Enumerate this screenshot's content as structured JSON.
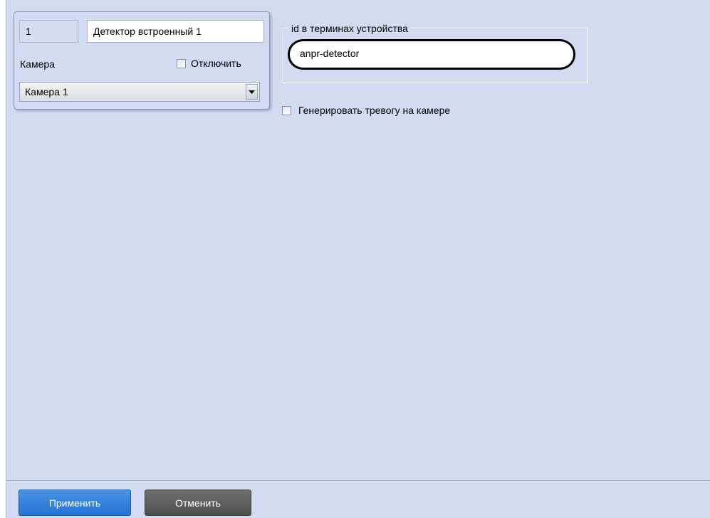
{
  "object_panel": {
    "id_value": "1",
    "name_value": "Детектор встроенный 1",
    "camera_label": "Камера",
    "disable_label": "Отключить",
    "disable_checked": false,
    "camera_selected": "Камера 1"
  },
  "device_group": {
    "legend": "id в терминах устройства",
    "device_id_value": "anpr-detector"
  },
  "alarm": {
    "label": "Генерировать тревогу на камере",
    "checked": false
  },
  "footer": {
    "apply_label": "Применить",
    "cancel_label": "Отменить"
  },
  "colors": {
    "panel_background": "#d3dbf3",
    "apply_button": "#2e7ddb",
    "cancel_button": "#5c5c5c"
  },
  "icons": {
    "select_arrow": "chevron-down-icon"
  }
}
